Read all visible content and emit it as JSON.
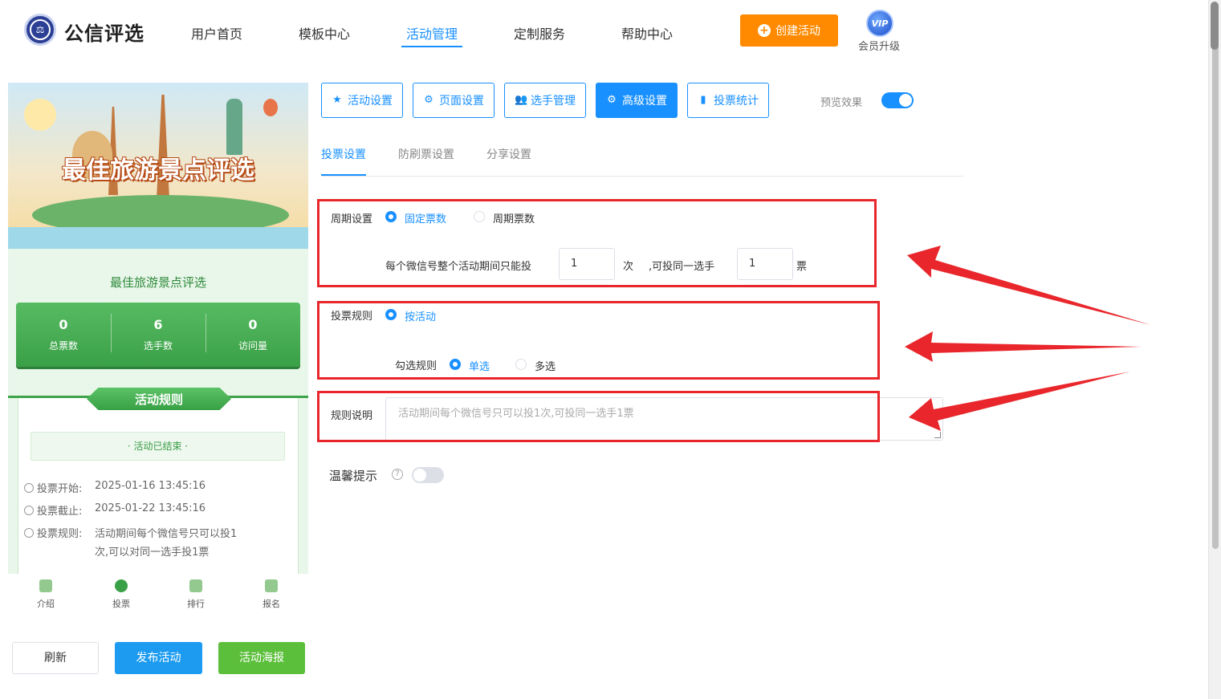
{
  "header": {
    "brand": "公信评选",
    "nav": [
      "用户首页",
      "模板中心",
      "活动管理",
      "定制服务",
      "帮助中心"
    ],
    "active_nav": "活动管理",
    "create_button": "创建活动",
    "vip_badge": "VIP",
    "vip_label": "会员升级"
  },
  "preview": {
    "banner_title": "最佳旅游景点评选",
    "activity_title": "最佳旅游景点评选",
    "stats": [
      {
        "value": "0",
        "label": "总票数"
      },
      {
        "value": "6",
        "label": "选手数"
      },
      {
        "value": "0",
        "label": "访问量"
      }
    ],
    "rules_title": "活动规则",
    "status": "· 活动已结束 ·",
    "vote_start_label": "投票开始:",
    "vote_start": "2025-01-16 13:45:16",
    "vote_end_label": "投票截止:",
    "vote_end": "2025-01-22 13:45:16",
    "vote_rule_label": "投票规则:",
    "vote_rule_line1": "活动期间每个微信号只可以投1",
    "vote_rule_line2": "次,可以对同一选手投1票",
    "tabs": [
      "介绍",
      "投票",
      "排行",
      "报名"
    ]
  },
  "bottom_buttons": {
    "refresh": "刷新",
    "publish": "发布活动",
    "poster": "活动海报"
  },
  "settings_tabs": [
    {
      "label": "活动设置",
      "icon": "star-icon"
    },
    {
      "label": "页面设置",
      "icon": "gear-icon"
    },
    {
      "label": "选手管理",
      "icon": "users-icon"
    },
    {
      "label": "高级设置",
      "icon": "settings-icon"
    },
    {
      "label": "投票统计",
      "icon": "bar-chart-icon"
    }
  ],
  "active_settings_tab": "高级设置",
  "preview_toggle": {
    "label": "预览效果",
    "on": true
  },
  "sub_tabs": [
    "投票设置",
    "防刷票设置",
    "分享设置"
  ],
  "active_sub_tab": "投票设置",
  "form": {
    "cycle_label": "周期设置",
    "cycle_options": [
      "固定票数",
      "周期票数"
    ],
    "cycle_selected": "固定票数",
    "per_account_text": "每个微信号整个活动期间只能投",
    "times_value": "1",
    "times_unit": "次",
    "same_player_text": ",可投同一选手",
    "votes_value": "1",
    "votes_unit": "票",
    "rule_label": "投票规则",
    "rule_option": "按活动",
    "select_rule_label": "勾选规则",
    "select_options": [
      "单选",
      "多选"
    ],
    "select_selected": "单选",
    "desc_label": "规则说明",
    "desc_placeholder": "活动期间每个微信号只可以投1次,可投同一选手1票",
    "tip_label": "温馨提示",
    "tip_help": "?",
    "tip_on": false
  },
  "colors": {
    "primary": "#1890ff",
    "orange": "#ff8a00",
    "green": "#3aa047",
    "annotation_red": "#e8262b"
  }
}
